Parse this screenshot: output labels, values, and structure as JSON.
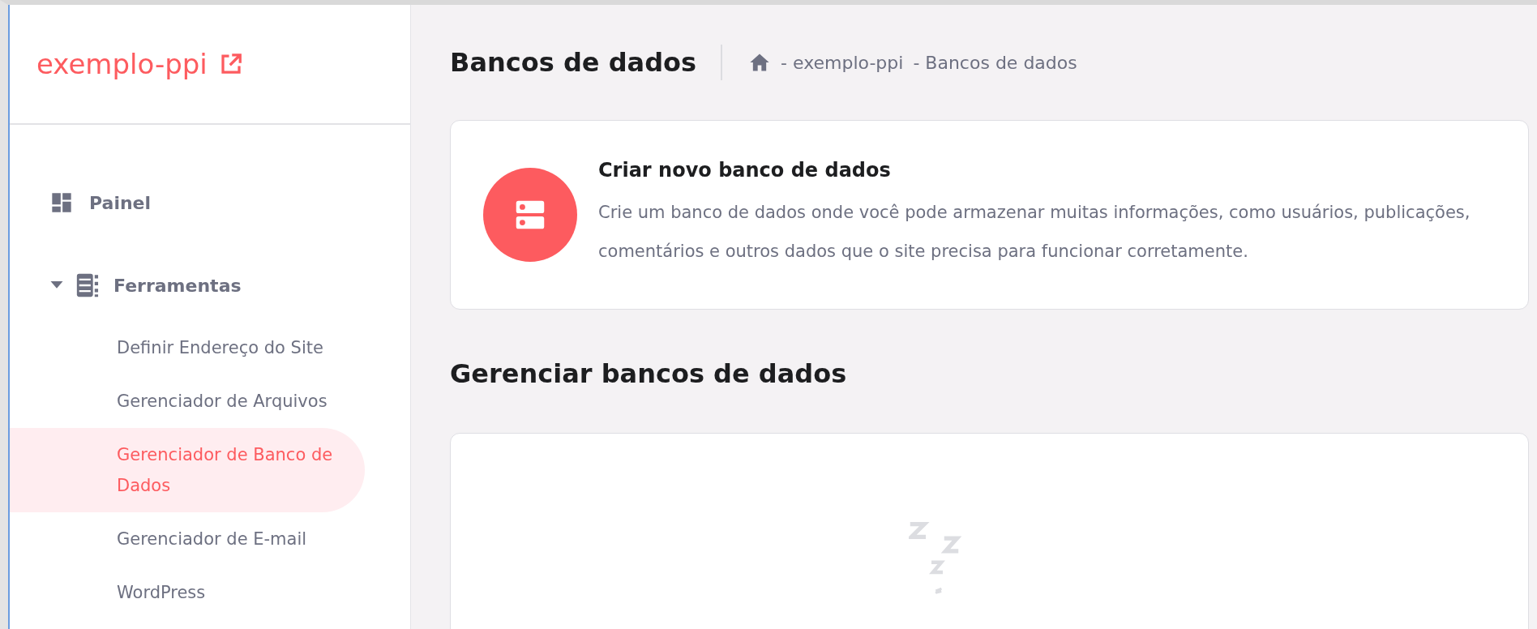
{
  "sidebar": {
    "site_name": "exemplo-ppi",
    "items": [
      {
        "label": "Painel",
        "kind": "link"
      },
      {
        "label": "Ferramentas",
        "kind": "group",
        "expanded": true,
        "children": [
          {
            "label": "Definir Endereço do Site",
            "selected": false
          },
          {
            "label": "Gerenciador de Arquivos",
            "selected": false
          },
          {
            "label": "Gerenciador de Banco de Dados",
            "selected": true
          },
          {
            "label": "Gerenciador de E-mail",
            "selected": false
          },
          {
            "label": "WordPress",
            "selected": false
          }
        ]
      }
    ]
  },
  "header": {
    "title": "Bancos de dados",
    "breadcrumb": [
      "- exemplo-ppi",
      "- Bancos de dados"
    ]
  },
  "create_card": {
    "title": "Criar novo banco de dados",
    "description": "Crie um banco de dados onde você pode armazenar muitas informações, como usuários, publicações, comentários e outros dados que o site precisa para funcionar corretamente."
  },
  "manage_section": {
    "title": "Gerenciar bancos de dados"
  }
}
